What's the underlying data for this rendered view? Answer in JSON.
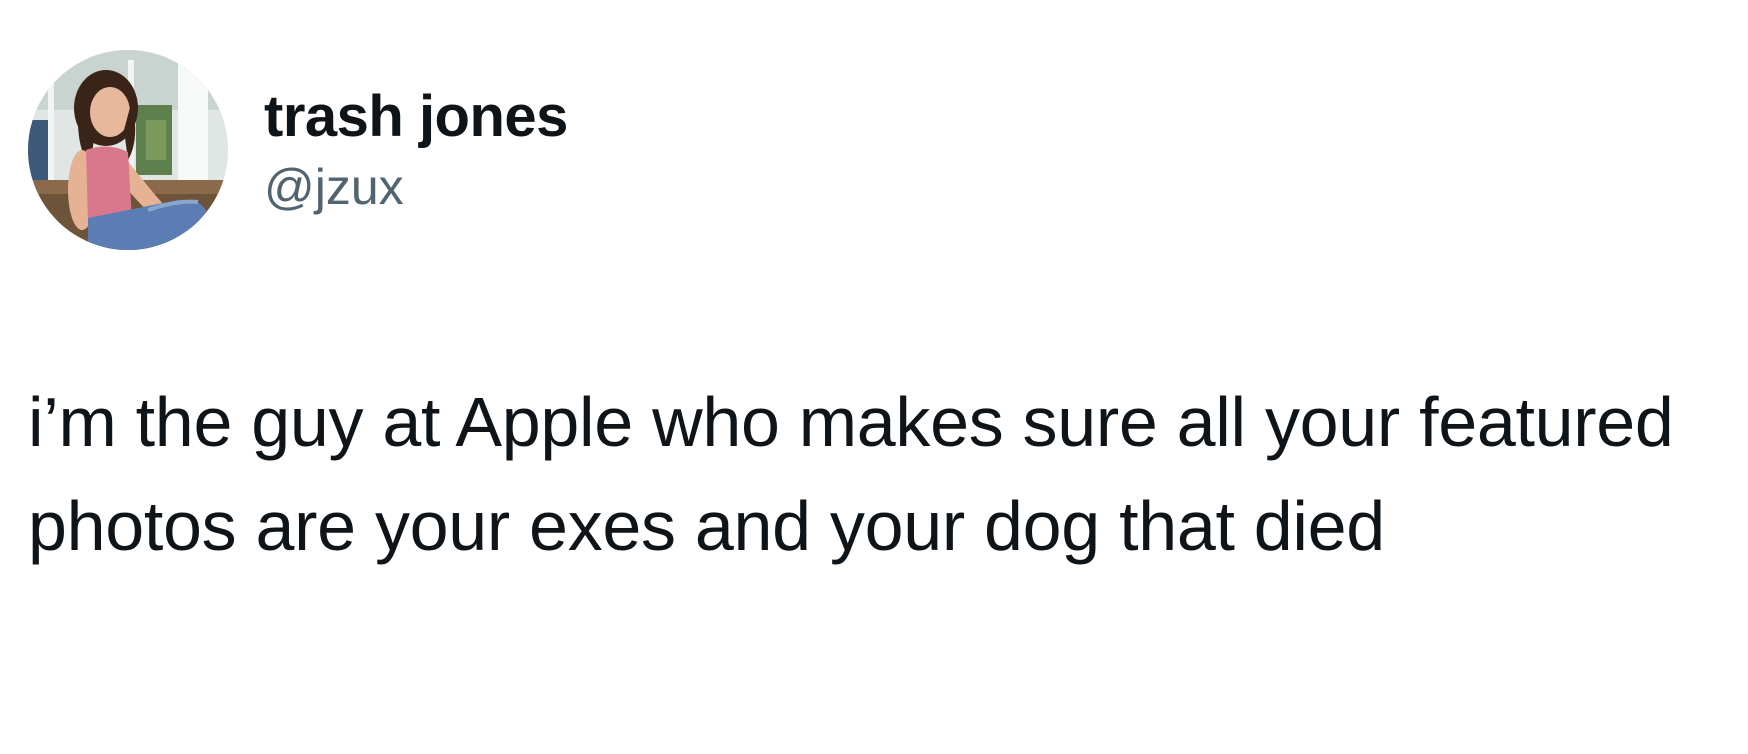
{
  "author": {
    "display_name": "trash jones",
    "handle": "@jzux",
    "avatar_icon": "profile-photo"
  },
  "tweet": {
    "text": "i’m the guy at Apple who makes sure all your featured photos are your exes and your dog that died"
  },
  "colors": {
    "background": "#ffffff",
    "text_primary": "#0f1419",
    "text_secondary": "#536471"
  }
}
